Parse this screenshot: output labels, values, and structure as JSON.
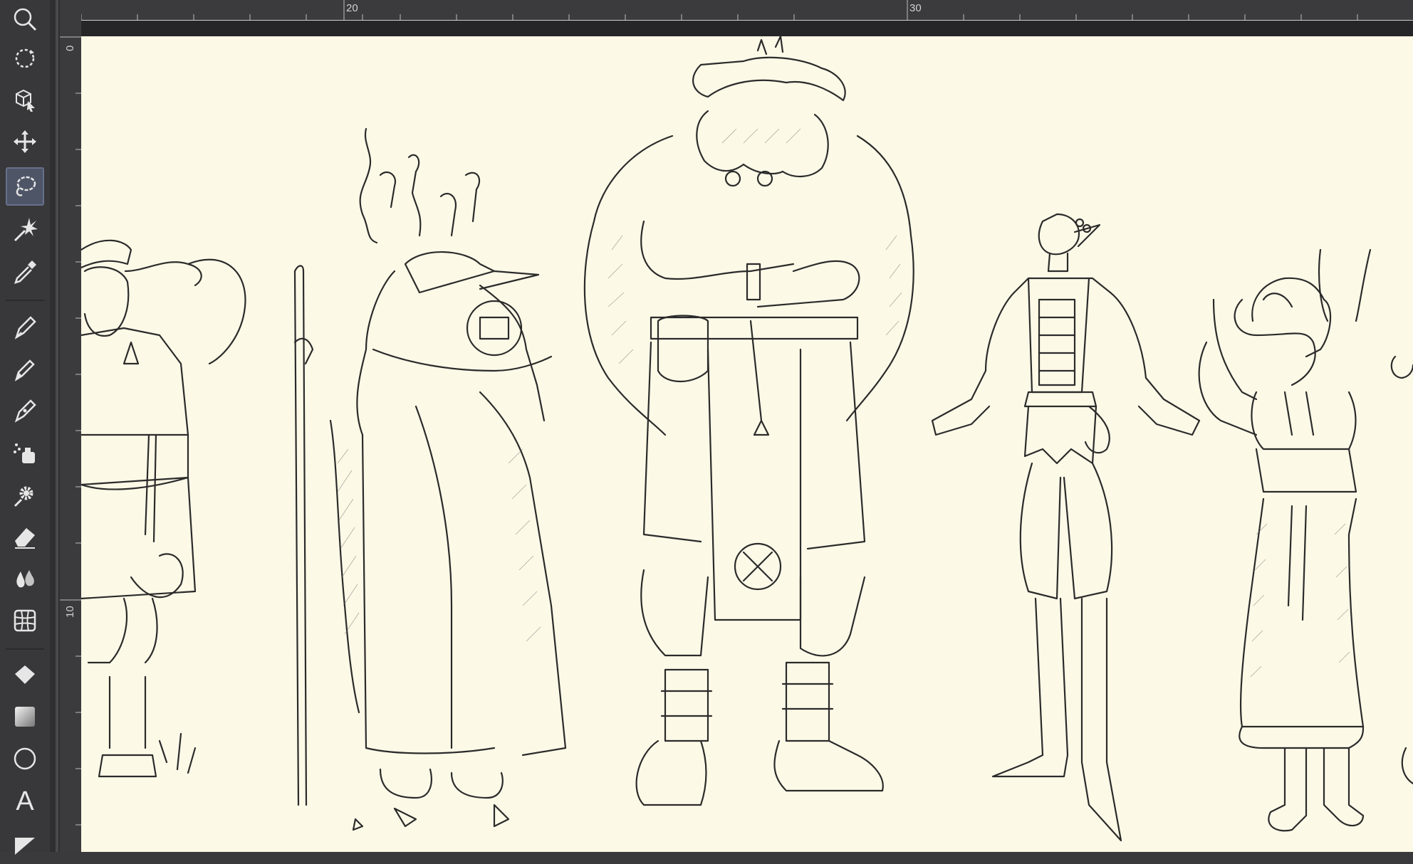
{
  "toolbar": {
    "tools": [
      {
        "name": "zoom-tool",
        "icon": "magnifier-icon"
      },
      {
        "name": "rotate-tool",
        "icon": "rotate-icon"
      },
      {
        "name": "3d-object-tool",
        "icon": "cube-cursor-icon"
      },
      {
        "name": "move-tool",
        "icon": "move-arrows-icon"
      },
      {
        "name": "lasso-tool",
        "icon": "lasso-icon",
        "active": true
      },
      {
        "name": "magic-wand-tool",
        "icon": "sparkle-icon"
      },
      {
        "name": "eyedropper-tool",
        "icon": "eyedropper-icon"
      },
      {
        "name": "pen-tool",
        "icon": "pen-icon"
      },
      {
        "name": "pencil-tool",
        "icon": "pencil-icon"
      },
      {
        "name": "brush-tool",
        "icon": "brush-icon"
      },
      {
        "name": "airbrush-tool",
        "icon": "airbrush-icon"
      },
      {
        "name": "decoration-tool",
        "icon": "gear-icon"
      },
      {
        "name": "eraser-tool",
        "icon": "eraser-icon"
      },
      {
        "name": "blend-tool",
        "icon": "drops-icon"
      },
      {
        "name": "mesh-transform-tool",
        "icon": "grid-icon"
      },
      {
        "name": "fill-tool",
        "icon": "bucket-icon"
      },
      {
        "name": "gradient-tool",
        "icon": "gradient-square-icon"
      },
      {
        "name": "figure-tool",
        "icon": "circle-icon"
      },
      {
        "name": "text-tool",
        "icon": "text-a-icon"
      },
      {
        "name": "frame-tool",
        "icon": "frame-icon"
      }
    ]
  },
  "ruler": {
    "top_labels": [
      "20",
      "30"
    ],
    "left_labels": [
      "0",
      "10"
    ]
  },
  "canvas": {
    "background": "#fdf9e7",
    "ink": "#2b2b2b",
    "figures": [
      "character-shielding-eyes",
      "robed-masked-figure-with-staff",
      "fur-cloaked-warrior",
      "jester-figure",
      "horned-youth-in-tunic"
    ]
  }
}
